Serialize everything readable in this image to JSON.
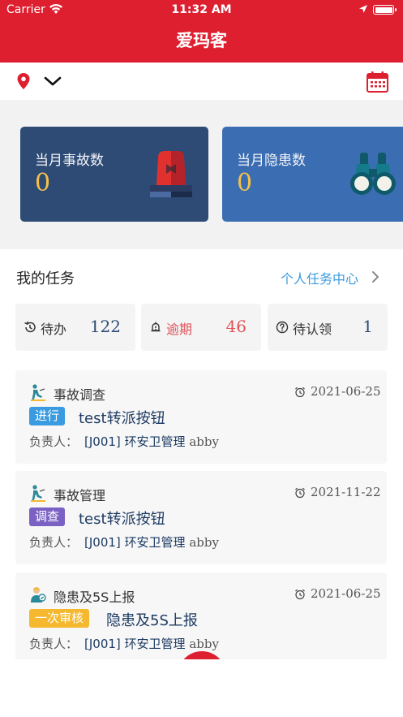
{
  "status_bar": {
    "carrier": "Carrier",
    "time": "11:32 AM"
  },
  "header": {
    "title": "爱玛客"
  },
  "location_bar": {
    "pin_icon": "location-pin-icon",
    "dropdown_icon": "chevron-down-icon",
    "calendar_icon": "calendar-icon"
  },
  "stats": [
    {
      "label": "当月事故数",
      "value": "0",
      "icon": "alarm-siren-icon"
    },
    {
      "label": "当月隐患数",
      "value": "0",
      "icon": "binoculars-icon"
    }
  ],
  "my_tasks": {
    "title": "我的任务",
    "link": "个人任务中心",
    "tabs": [
      {
        "label": "待办",
        "count": "122",
        "icon": "history-icon"
      },
      {
        "label": "逾期",
        "count": "46",
        "icon": "bell-alert-icon"
      },
      {
        "label": "待认领",
        "count": "1",
        "icon": "question-circle-icon"
      }
    ],
    "owner_label": "负责人：",
    "items": [
      {
        "type": "事故调查",
        "date": "2021-06-25",
        "badge": "进行",
        "badge_color": "#3a9be0",
        "title": "test转派按钮",
        "owner": "[J001] 环安卫管理",
        "user": "abby"
      },
      {
        "type": "事故管理",
        "date": "2021-11-22",
        "badge": "调查",
        "badge_color": "#7b61c4",
        "title": "test转派按钮",
        "owner": "[J001] 环安卫管理",
        "user": "abby"
      },
      {
        "type": "隐患及5S上报",
        "date": "2021-06-25",
        "badge": "一次审核",
        "badge_color": "#f5b82e",
        "title": "隐患及5S上报",
        "owner": "[J001] 环安卫管理",
        "user": "abby"
      }
    ]
  },
  "colors": {
    "brand": "#dd1f30",
    "card_dark": "#2e4b75",
    "card_blue": "#3b6db2",
    "link": "#3a9be0",
    "warn": "#e0545a"
  }
}
